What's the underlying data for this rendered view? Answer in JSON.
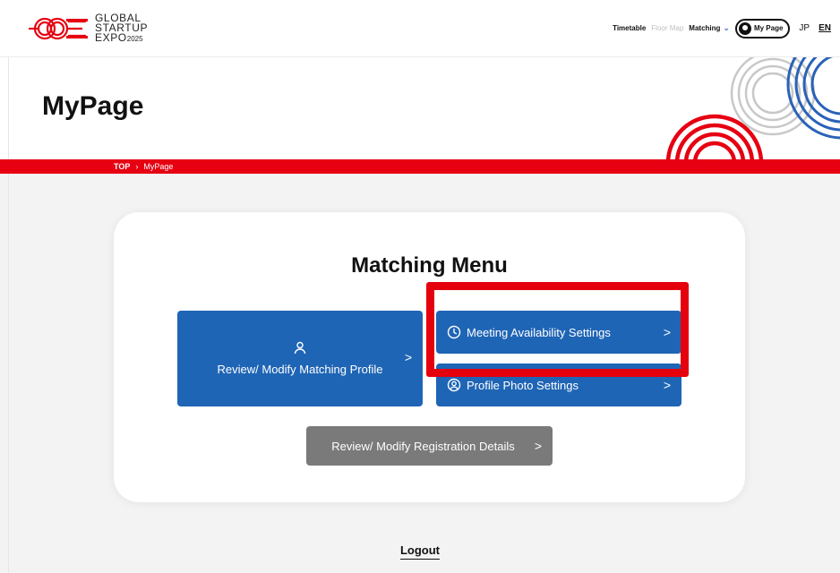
{
  "header": {
    "logo_line1": "GLOBAL",
    "logo_line2": "STARTUP",
    "logo_line3": "EXPO",
    "logo_year": "2025",
    "nav_timetable": "Timetable",
    "nav_floor_map": "Floor Map",
    "nav_matching": "Matching",
    "nav_mypage": "My Page",
    "lang_jp": "JP",
    "lang_en": "EN"
  },
  "hero": {
    "title": "MyPage"
  },
  "breadcrumb": {
    "top": "TOP",
    "separator": "›",
    "current": "MyPage"
  },
  "menu": {
    "title": "Matching Menu",
    "profile_label": "Review/ Modify Matching Profile",
    "meeting_label": "Meeting Availability Settings",
    "photo_label": "Profile Photo Settings",
    "registration_label": "Review/ Modify Registration Details",
    "arrow": ">"
  },
  "footer": {
    "logout": "Logout"
  },
  "colors": {
    "brand_red": "#e60012",
    "button_blue": "#1f65b5",
    "button_gray": "#7a7a7a",
    "highlight_red": "#e5000e"
  }
}
